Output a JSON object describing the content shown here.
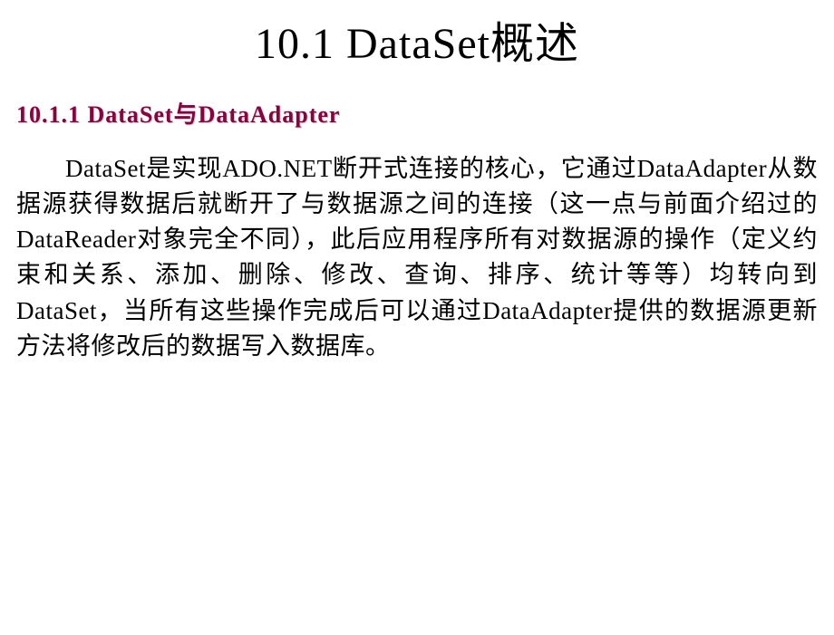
{
  "slide": {
    "title": "10.1  DataSet概述",
    "subtitle": "10.1.1  DataSet与DataAdapter",
    "body": "DataSet是实现ADO.NET断开式连接的核心，它通过DataAdapter从数据源获得数据后就断开了与数据源之间的连接（这一点与前面介绍过的DataReader对象完全不同），此后应用程序所有对数据源的操作（定义约束和关系、添加、删除、修改、查询、排序、统计等等）均转向到DataSet，当所有这些操作完成后可以通过DataAdapter提供的数据源更新方法将修改后的数据写入数据库。"
  }
}
